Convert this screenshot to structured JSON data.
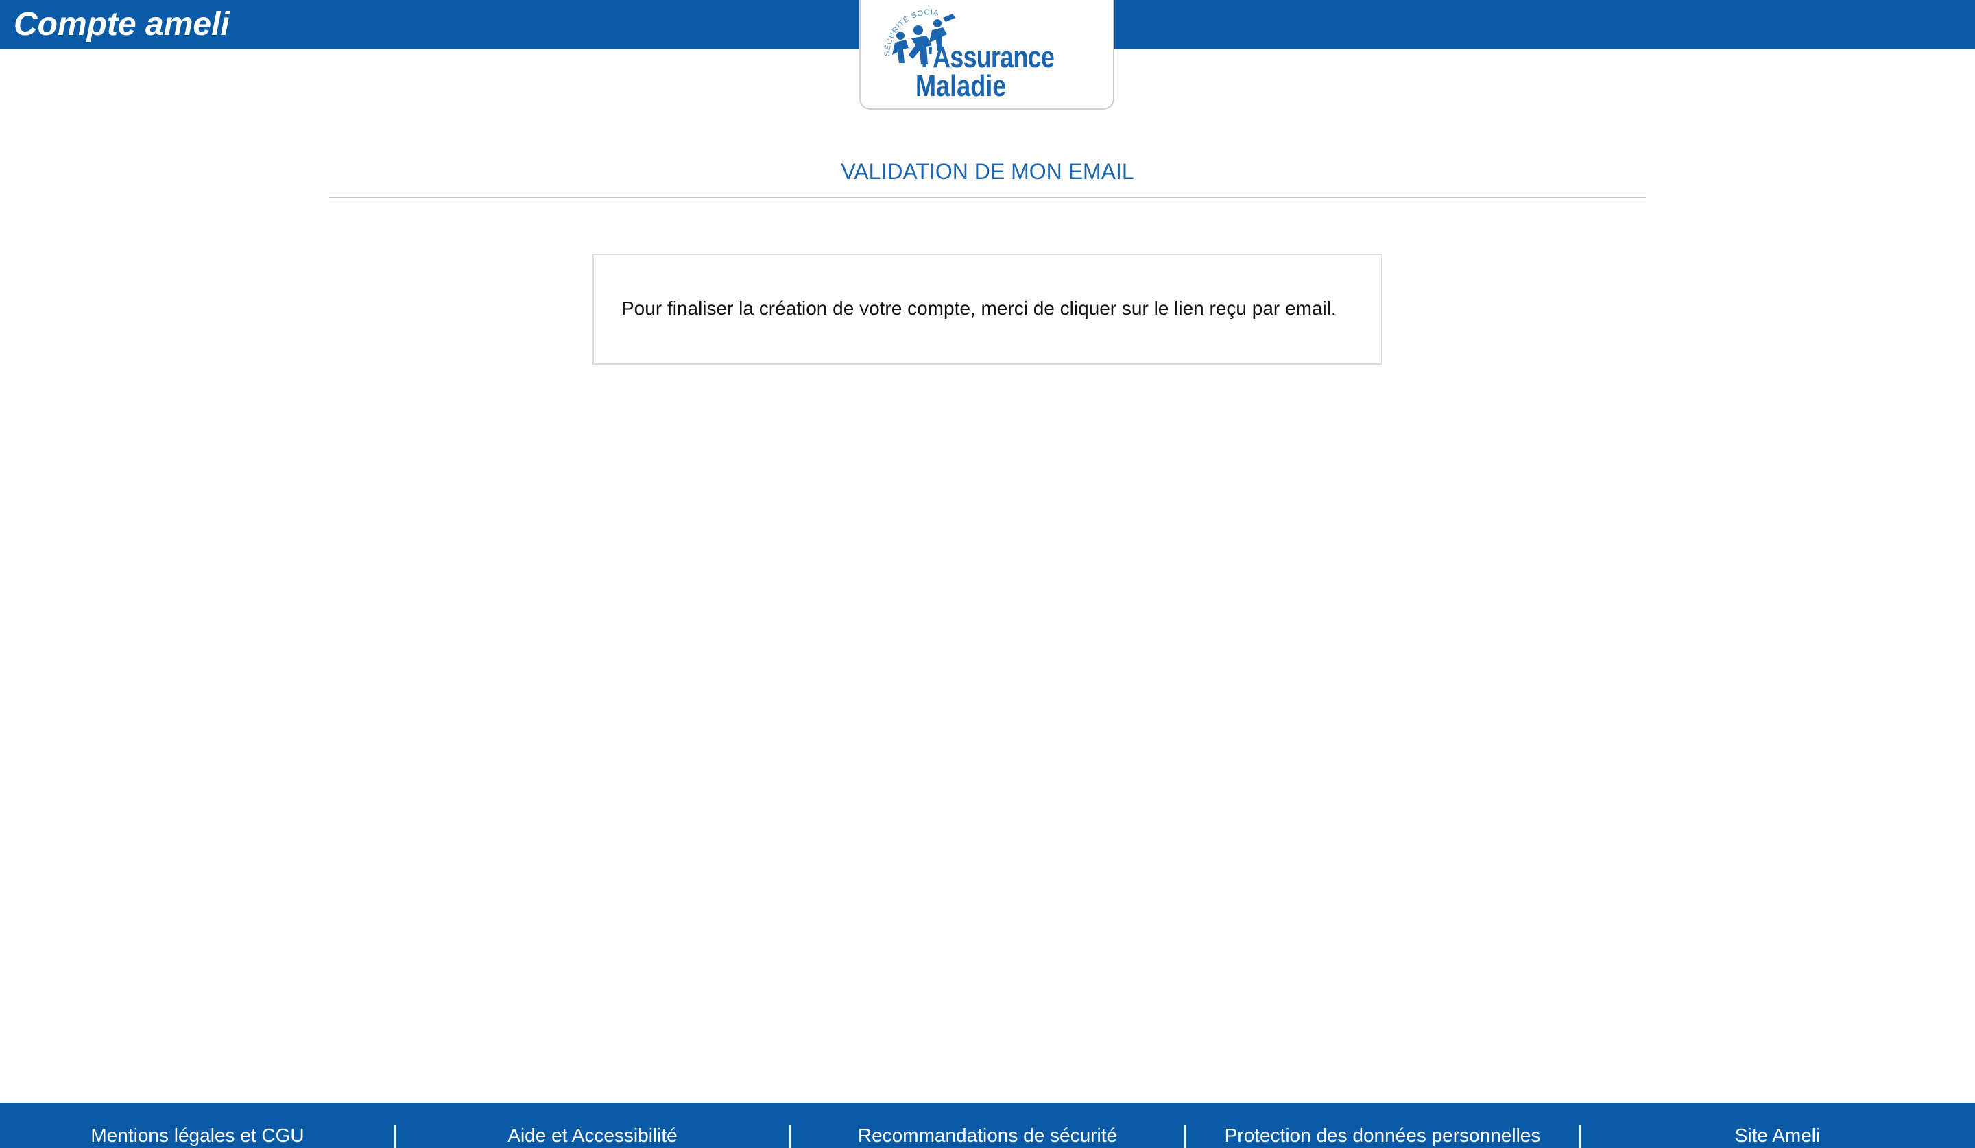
{
  "header": {
    "app_title": "Compte ameli",
    "logo": {
      "arc_text": "SÉCURITÉ SOCIALE",
      "line1": "l'Assurance",
      "line2": "Maladie"
    }
  },
  "main": {
    "heading": "VALIDATION DE MON EMAIL",
    "message": "Pour finaliser la création de votre compte, merci de cliquer sur le lien reçu par email."
  },
  "footer": {
    "links": [
      "Mentions légales et CGU",
      "Aide et Accessibilité",
      "Recommandations de sécurité",
      "Protection des données personnelles",
      "Site Ameli"
    ]
  },
  "colors": {
    "brand_blue": "#0a5aa5",
    "heading_blue": "#1d65ae",
    "logo_blue": "#1b64b0"
  }
}
